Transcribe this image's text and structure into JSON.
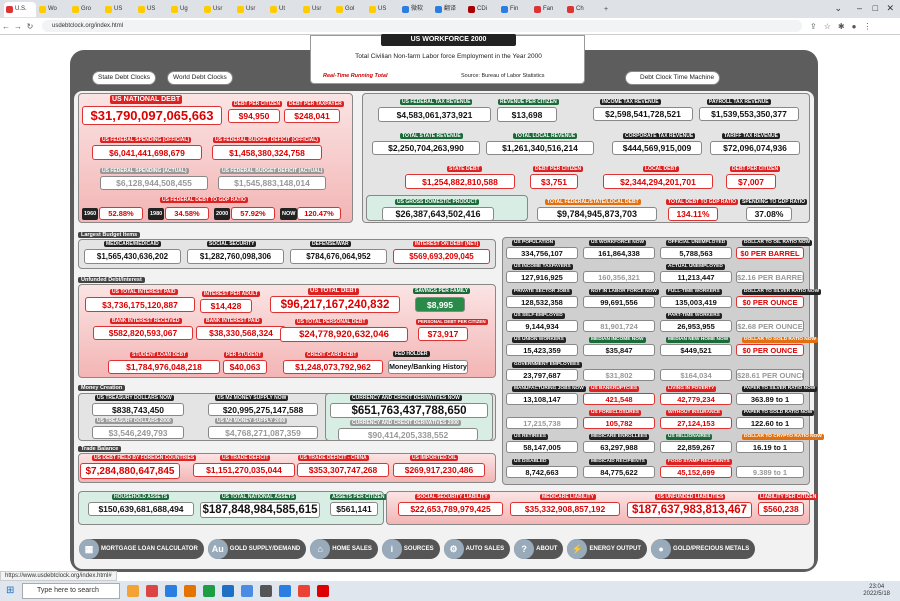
{
  "browser": {
    "tabs": [
      "U.S.",
      "Wo",
      "Gro",
      "US",
      "US",
      "Ug",
      "Usr",
      "Usr",
      "Ut",
      "Usr",
      "Gol",
      "US",
      "微软",
      "翻译",
      "CDi",
      "Fin",
      "Fan",
      "Ch"
    ],
    "url": "usdebtclock.org/index.html",
    "status_url": "https://www.usdebtclock.org/index.html#"
  },
  "header": {
    "title": "US WORKFORCE 2000",
    "subtitle": "Total Civilian Non-farm Labor force Employment in the Year 2000",
    "realtime": "Real-Time Running Total",
    "source": "Source: Bureau of Labor Statistics"
  },
  "top_buttons": {
    "state": "State Debt Clocks",
    "world": "World Debt Clocks",
    "machine": "Debt Clock Time Machine"
  },
  "national": {
    "debt_label": "US NATIONAL DEBT",
    "debt": "$31,790,097,065,663",
    "per_citizen_label": "DEBT PER CITIZEN",
    "per_citizen": "$94,950",
    "per_taxpayer_label": "DEBT PER TAXPAYER",
    "per_taxpayer": "$248,041",
    "spending_label": "US FEDERAL SPENDING (OFFICIAL)",
    "spending": "$6,041,441,698,679",
    "deficit_label": "US FEDERAL BUDGET DEFICIT (OFFICIAL)",
    "deficit": "$1,458,380,324,758",
    "spending_actual_label": "US FEDERAL SPENDING (ACTUAL)",
    "spending_actual": "$6,128,944,508,455",
    "deficit_actual_label": "US FEDERAL BUDGET DEFICIT (ACTUAL)",
    "deficit_actual": "$1,545,883,148,014",
    "gdp_ratio_label": "US FEDERAL DEBT TO GDP RATIO",
    "ratios": [
      {
        "year": "1960",
        "v": "52.88%"
      },
      {
        "year": "1980",
        "v": "34.58%"
      },
      {
        "year": "2000",
        "v": "57.92%"
      },
      {
        "year": "NOW",
        "v": "120.47%"
      }
    ]
  },
  "revenue": {
    "fed_label": "US FEDERAL TAX REVENUE",
    "fed": "$4,583,061,373,921",
    "per_citizen_label": "REVENUE PER CITIZEN",
    "per_citizen": "$13,698",
    "income_label": "INCOME TAX REVENUE",
    "income": "$2,598,541,728,521",
    "payroll_label": "PAYROLL TAX REVENUE",
    "payroll": "$1,539,553,350,377",
    "state_label": "TOTAL STATE REVENUE",
    "state": "$2,250,704,263,990",
    "local_label": "TOTAL LOCAL REVENUE",
    "local": "$1,261,340,516,214",
    "corp_label": "CORPORATE TAX REVENUE",
    "corp": "$444,569,915,009",
    "tariff_label": "TARIFF TAX REVENUE",
    "tariff": "$72,096,074,936",
    "state_debt_label": "STATE DEBT",
    "state_debt": "$1,254,882,810,588",
    "state_per_label": "DEBT PER CITIZEN",
    "state_per": "$3,751",
    "local_debt_label": "LOCAL DEBT",
    "local_debt": "$2,344,294,201,701",
    "local_per_label": "DEBT PER CITIZEN",
    "local_per": "$7,007",
    "gdp_label": "US GROSS DOMESTIC PRODUCT",
    "gdp": "$26,387,643,502,416",
    "total_debt_label": "TOTAL FEDERAL/STATE/LOCAL DEBT",
    "total_debt": "$9,784,945,873,703",
    "total_gdp_label": "TOTAL DEBT TO GDP RATIO",
    "total_gdp": "134.11%",
    "spend_gdp_label": "SPENDING TO GDP RATIO",
    "spend_gdp": "37.08%"
  },
  "budget": {
    "title": "Largest Budget Items",
    "items": [
      {
        "label": "MEDICARE/MEDICAID",
        "v": "$1,565,430,636,202"
      },
      {
        "label": "SOCIAL SECURITY",
        "v": "$1,282,760,098,306"
      },
      {
        "label": "DEFENSE/WAR",
        "v": "$784,676,064,952"
      },
      {
        "label": "INTEREST ON DEBT (NET)",
        "v": "$569,693,209,045"
      }
    ]
  },
  "unfunded": {
    "title": "Unfunded Debt/Interest",
    "interest_paid_label": "US TOTAL INTEREST PAID",
    "interest_paid": "$3,736,175,120,887",
    "interest_adult_label": "INTEREST PER ADULT",
    "interest_adult": "$14,428",
    "bank_received_label": "BANK INTEREST RECEIVED",
    "bank_received": "$582,820,593,067",
    "bank_paid_label": "BANK INTEREST PAID",
    "bank_paid": "$38,330,568,324",
    "personal_debt_label": "US TOTAL DEBT",
    "personal_debt": "$96,217,167,240,832",
    "savings_label": "SAVINGS PER FAMILY",
    "savings": "$8,995",
    "total_personal_label": "US TOTAL PERSONAL DEBT",
    "total_personal": "$24,778,920,632,046",
    "personal_per_label": "PERSONAL DEBT PER CITIZEN",
    "personal_per": "$73,917",
    "student_label": "STUDENT LOAN DEBT",
    "student": "$1,784,976,048,218",
    "per_student_label": "PER STUDENT",
    "per_student": "$40,063",
    "credit_label": "CREDIT CARD DEBT",
    "credit": "$1,248,073,792,962",
    "fed_holder_label": "FED HOLDER",
    "fed_holder": "Money/Banking History"
  },
  "money": {
    "title": "Money Creation",
    "treasury_label": "US TREASURY DOLLARS NOW",
    "treasury": "$838,743,450",
    "treasury2000_label": "US TREASURY DOLLARS 2000",
    "treasury2000": "$3,546,249,793",
    "m2_label": "US M2 MONEY SUPPLY NOW",
    "m2": "$20,995,275,147,588",
    "m2_2000_label": "US M2 MONEY SUPPLY 2000",
    "m2_2000": "$4,768,271,087,359",
    "deriv_label": "CURRENCY AND CREDIT DERIVATIVES NOW",
    "deriv": "$651,763,437,788,650",
    "deriv2000_label": "CURRENCY AND CREDIT DERIVATIVES 2000",
    "deriv2000": "$90,414,205,338,552"
  },
  "trade": {
    "title": "Trade Balance",
    "foreign_label": "US DEBT HELD BY FOREIGN COUNTRIES",
    "foreign": "$7,284,880,647,845",
    "trade_label": "US TRADE DEFICIT",
    "trade": "$1,151,270,035,044",
    "china_label": "US TRADE DEFICIT - CHINA",
    "china": "$353,307,747,268",
    "oil_label": "US IMPORTED OIL",
    "oil": "$269,917,230,486"
  },
  "assets": {
    "household_label": "HOUSEHOLD ASSETS",
    "household": "$150,639,681,688,494",
    "national_label": "US TOTAL NATIONAL ASSETS",
    "national": "$187,848,984,585,615",
    "per_citizen_label": "ASSETS PER CITIZEN",
    "per_citizen": "$561,141",
    "ss_label": "SOCIAL SECURITY LIABILITY",
    "ss": "$22,653,789,979,425",
    "medicare_label": "MEDICARE LIABILITY",
    "medicare": "$35,332,908,857,192",
    "unfunded_label": "US UNFUNDED LIABILITIES",
    "unfunded": "$187,637,983,813,467",
    "liab_label": "LIABILITY PER CITIZEN",
    "liab": "$560,238"
  },
  "stats": {
    "population_label": "US POPULATION",
    "population": "334,756,107",
    "workforce_label": "US WORKFORCE NOW",
    "workforce": "161,864,338",
    "workforce2000": "160,356,321",
    "taxpayers_label": "US INCOME TAXPAYERS",
    "taxpayers": "127,916,925",
    "unemployed_label": "OFFICIAL UNEMPLOYED",
    "unemployed": "5,788,563",
    "actual_unemp_label": "ACTUAL UNEMPLOYED",
    "actual_unemp": "11,213,447",
    "oil_label": "DOLLAR TO OIL RATIO NOW",
    "oil": "$0 PER BARREL",
    "oil2000": "$2.16 PER BARREL",
    "private_label": "PRIVATE SECTOR JOBS",
    "private": "128,532,358",
    "notlabor_label": "NOT IN LABOR FORCE NOW",
    "notlabor": "99,691,556",
    "fulltime_label": "FULL-TIME WORKERS",
    "fulltime": "135,003,419",
    "silver_label": "DOLLAR TO SILVER RATIO NOW",
    "silver": "$0 PER OUNCE",
    "self_label": "US SELF-EMPLOYED",
    "self": "9,144,934",
    "notlabor2000": "81,901,724",
    "parttime_label": "PART-TIME WORKERS",
    "parttime": "26,953,955",
    "silver2000": "$2.68 PER OUNCE",
    "union_label": "US UNION WORKERS",
    "union": "15,423,359",
    "income_label": "MEDIAN INCOME NOW",
    "income": "$35,847",
    "home_label": "MEDIAN NEW HOME NOW",
    "home": "$449,521",
    "gold_label": "DOLLAR TO GOLD RATIO NOW",
    "gold": "$0 PER OUNCE",
    "govt_label": "GOVERNMENT EMPLOYEES",
    "govt": "23,797,687",
    "income2000": "$31,802",
    "home2000": "$164,034",
    "gold2000": "$28.61 PER OUNCE",
    "mfg_label": "MANUFACTURING JOBS NOW",
    "mfg": "13,108,147",
    "mfg2000": "17,215,738",
    "bankrupt_label": "US BANKRUPTCIES",
    "bankrupt": "421,548",
    "poverty_label": "LIVING IN POVERTY",
    "poverty": "42,779,234",
    "ps_label": "PAPER TO SILVER RATIO NOW",
    "ps": "363.89 to 1",
    "foreclose_label": "US FORECLOSURES",
    "foreclose": "105,782",
    "noins_label": "WITHOUT INSURANCE",
    "noins": "27,124,153",
    "pg_label": "PAPER TO GOLD RATIO NOW",
    "pg": "122.60 to 1",
    "retire_label": "US RETIREES",
    "retire": "58,147,005",
    "enroll_label": "MEDICARE ENROLLEES",
    "enroll": "63,297,988",
    "millionaires_label": "US MILLIONAIRES",
    "millionaires": "22,859,267",
    "crypto_label": "DOLLAR TO CRYPTO RATIO NOW",
    "crypto": "16.19 to 1",
    "disabled_label": "US DISABLED",
    "disabled": "8,742,663",
    "recipients_label": "MEDICAID RECIPIENTS",
    "recipients": "84,775,622",
    "stamp_label": "FOOD STAMP RECIPIENTS",
    "stamp": "45,152,699",
    "crypto2": "9.389 to 1"
  },
  "nav": [
    "MORTGAGE LOAN CALCULATOR",
    "GOLD SUPPLY/DEMAND",
    "HOME SALES",
    "SOURCES",
    "AUTO SALES",
    "ABOUT",
    "ENERGY OUTPUT",
    "GOLD/PRECIOUS METALS"
  ],
  "taskbar": {
    "search": "Type here to search",
    "time": "23:04",
    "date": "2022/5/18"
  },
  "colors": {
    "red": "#d22",
    "green": "#1b6b3a",
    "grey": "#5d5d5d"
  }
}
